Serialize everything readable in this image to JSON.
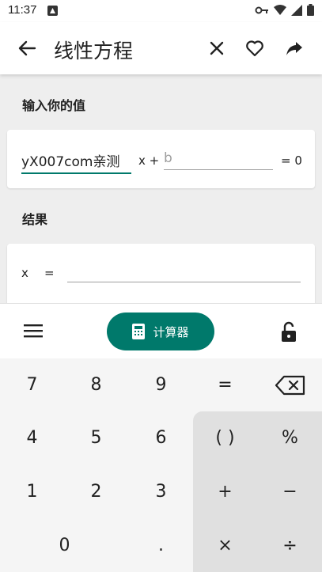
{
  "status": {
    "time": "11:37"
  },
  "appbar": {
    "title": "线性方程"
  },
  "input_section": {
    "label": "输入你的值",
    "a_value": "yX007com亲测",
    "x_plus": "x +",
    "b_placeholder": "b",
    "eq_zero": "= 0"
  },
  "result_section": {
    "label": "结果",
    "x_label": "x",
    "eq_sign": "="
  },
  "keyboard_bar": {
    "calc_label": "计算器"
  },
  "keys": {
    "k7": "7",
    "k8": "8",
    "k9": "9",
    "eq": "=",
    "k4": "4",
    "k5": "5",
    "k6": "6",
    "paren": "( )",
    "pct": "%",
    "k1": "1",
    "k2": "2",
    "k3": "3",
    "plus": "+",
    "minus": "−",
    "k0": "0",
    "dot": ".",
    "mul": "×",
    "div": "÷"
  },
  "colors": {
    "accent": "#00796b",
    "op_zone": "#e0e0e0",
    "keypad_bg": "#f5f5f5"
  }
}
